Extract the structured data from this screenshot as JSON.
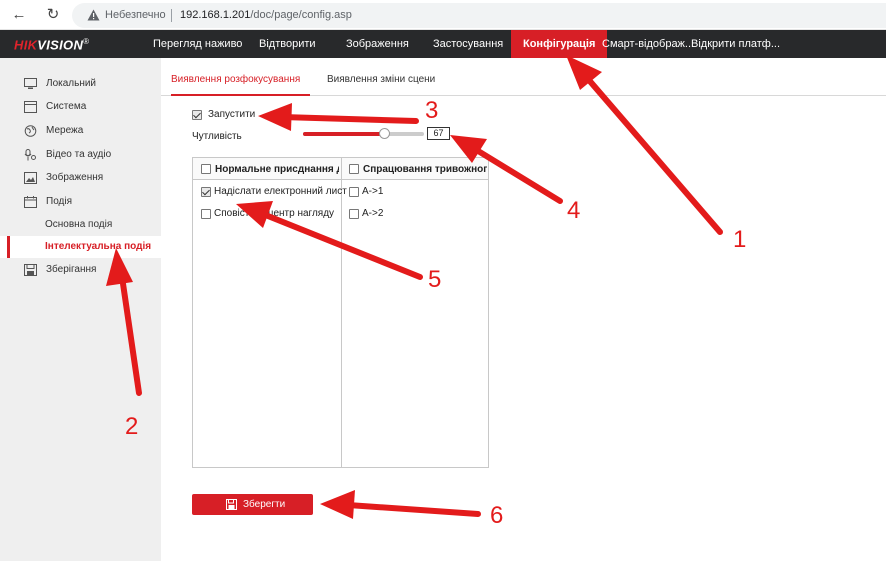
{
  "browser": {
    "back_icon": "arrow-left-icon",
    "reload_icon": "reload-icon",
    "security_label": "Небезпечно",
    "url_host": "192.168.1.201",
    "url_path": "/doc/page/config.asp"
  },
  "topnav": {
    "logo_red": "HIK",
    "logo_white": "VISION",
    "logo_mark": "®",
    "items": [
      "Перегляд наживо",
      "Відтворити",
      "Зображення",
      "Застосування",
      "Конфігурація",
      "Смарт-відображ...",
      "Відкрити платф..."
    ],
    "active_index": 4
  },
  "sidebar": {
    "items": [
      {
        "label": "Локальний",
        "icon": "monitor-icon"
      },
      {
        "label": "Система",
        "icon": "system-window-icon"
      },
      {
        "label": "Мережа",
        "icon": "globe-icon"
      },
      {
        "label": "Відео та аудіо",
        "icon": "microphone-icon"
      },
      {
        "label": "Зображення",
        "icon": "image-icon"
      },
      {
        "label": "Подія",
        "icon": "calendar-icon"
      }
    ],
    "sub_items": [
      "Основна подія",
      "Інтелектуальна подія"
    ],
    "active_sub_index": 1,
    "storage": {
      "label": "Зберігання",
      "icon": "storage-icon"
    }
  },
  "tabs": [
    "Виявлення розфокусування",
    "Виявлення зміни сцени"
  ],
  "active_tab": 0,
  "form": {
    "enable_label": "Запустити",
    "enable_checked": true,
    "sensitivity_label": "Чутливість",
    "sensitivity_value": "67",
    "sensitivity_max": 100
  },
  "linkage": {
    "normal_header": "Нормальне присднання дії",
    "normal_items": [
      {
        "label": "Надіслати електронний лист",
        "checked": true
      },
      {
        "label": "Сповістити центр нагляду",
        "checked": false
      }
    ],
    "alarm_header": "Спрацювання тривожного виходу",
    "alarm_items": [
      {
        "label": "A->1",
        "checked": false
      },
      {
        "label": "A->2",
        "checked": false
      }
    ]
  },
  "save_button": {
    "label": "Зберегти",
    "icon": "floppy-disk-icon"
  },
  "annotations": {
    "numbers": [
      "1",
      "2",
      "3",
      "4",
      "5",
      "6"
    ],
    "color": "#e31b1b"
  },
  "colors": {
    "accent": "#d71f26",
    "nav_bg": "#28292b",
    "sidebar_bg": "#efefef"
  }
}
